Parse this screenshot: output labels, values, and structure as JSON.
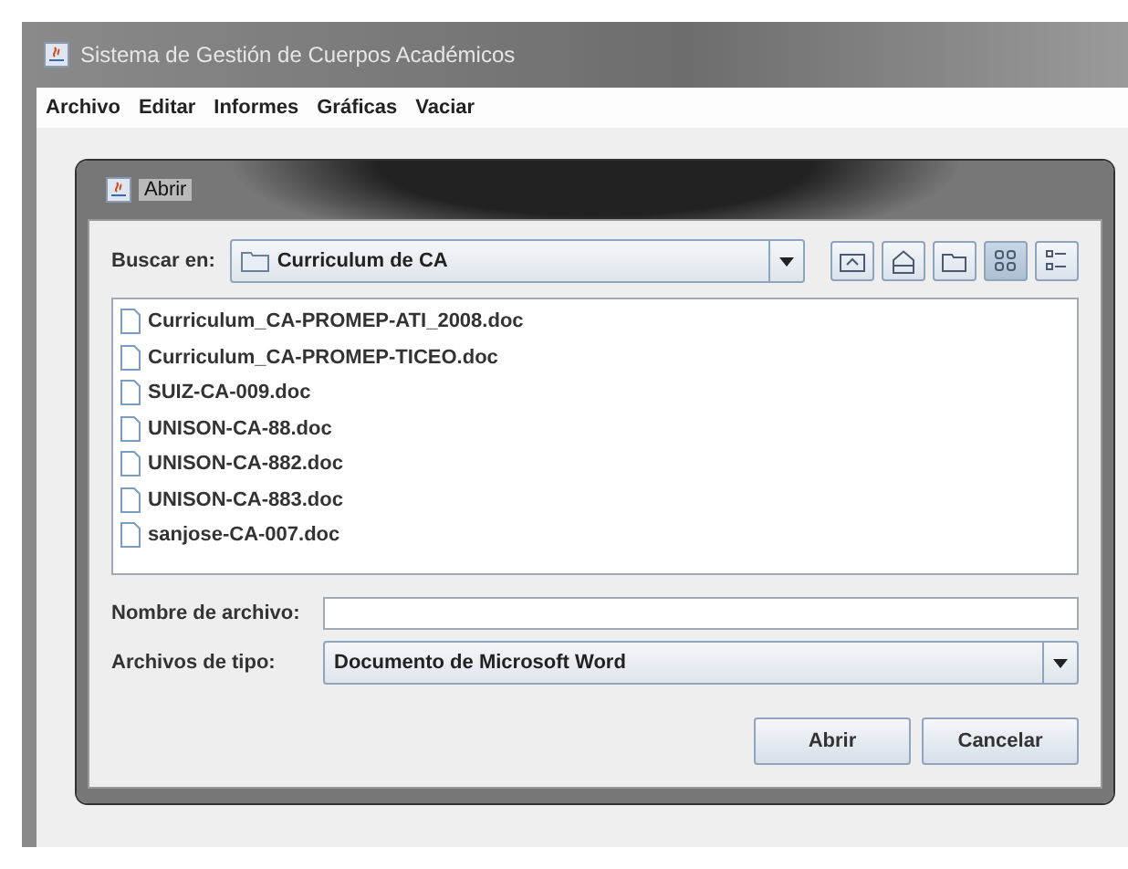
{
  "window": {
    "title": "Sistema de Gestión de Cuerpos Académicos"
  },
  "menu": [
    "Archivo",
    "Editar",
    "Informes",
    "Gráficas",
    "Vaciar"
  ],
  "dialog": {
    "title": "Abrir",
    "look_in": {
      "label": "Buscar en:",
      "value": "Curriculum de CA"
    },
    "toolbar": [
      {
        "kind": "up",
        "selected": false
      },
      {
        "kind": "home",
        "selected": false
      },
      {
        "kind": "newfolder",
        "selected": false
      },
      {
        "kind": "list",
        "selected": true
      },
      {
        "kind": "details",
        "selected": false
      }
    ],
    "files": [
      {
        "name": "Curriculum_CA-PROMEP-ATI_2008.doc"
      },
      {
        "name": "Curriculum_CA-PROMEP-TICEO.doc"
      },
      {
        "name": "SUIZ-CA-009.doc"
      },
      {
        "name": "UNISON-CA-88.doc"
      },
      {
        "name": "UNISON-CA-882.doc"
      },
      {
        "name": "UNISON-CA-883.doc"
      },
      {
        "name": "sanjose-CA-007.doc"
      }
    ],
    "file_name": {
      "label": "Nombre de archivo:"
    },
    "file_type": {
      "label": "Archivos de tipo:",
      "value": "Documento de Microsoft Word"
    },
    "buttons": [
      "Abrir",
      "Cancelar"
    ]
  }
}
